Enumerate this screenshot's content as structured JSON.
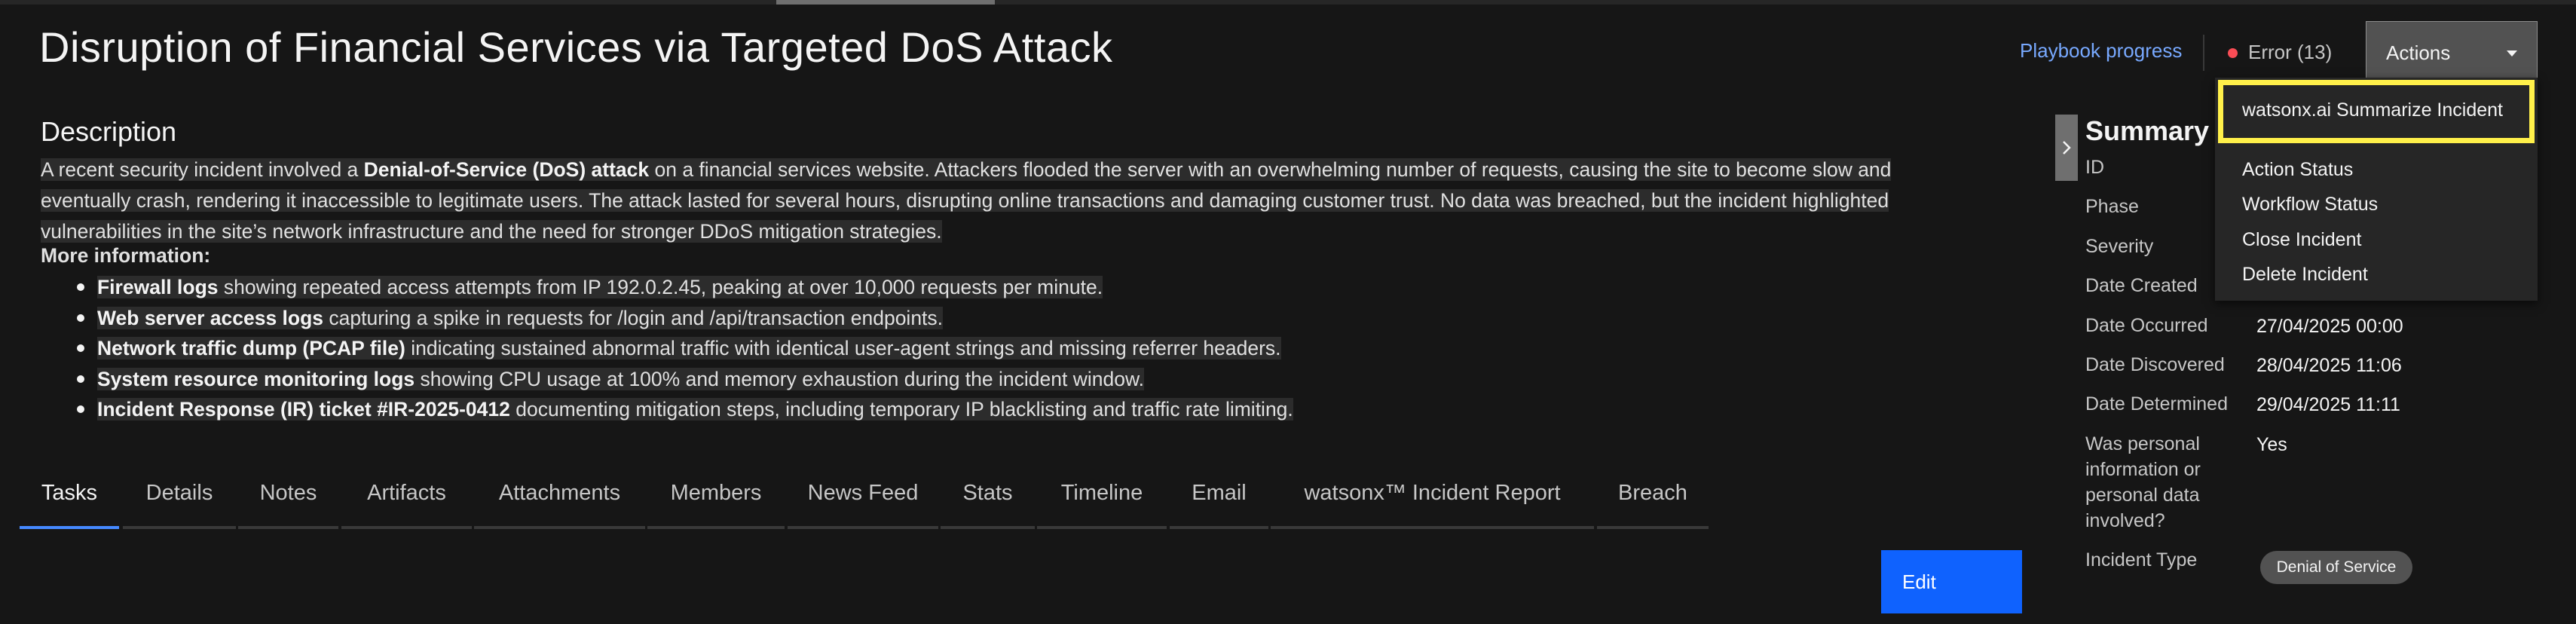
{
  "header": {
    "title": "Disruption of Financial Services via Targeted DoS Attack",
    "playbook_progress": "Playbook progress",
    "error": "Error (13)",
    "actions_label": "Actions"
  },
  "actions_menu": {
    "items": [
      "watsonx.ai Summarize Incident",
      "Action Status",
      "Workflow Status",
      "Close Incident",
      "Delete Incident"
    ]
  },
  "description": {
    "heading": "Description",
    "intro_before": "A recent security incident involved a ",
    "intro_bold": "Denial-of-Service (DoS) attack",
    "intro_after": " on a financial services website. Attackers flooded the server with an overwhelming number of requests, causing the site to become slow and eventually crash, rendering it inaccessible to legitimate users. The attack lasted for several hours, disrupting online transactions and damaging customer trust. No data was breached, but the incident highlighted vulnerabilities in the site’s network infrastructure and the need for stronger DDoS mitigation strategies.",
    "more_heading": "More information:",
    "bullets": [
      {
        "bold": "Firewall logs",
        "text": " showing repeated access attempts from IP 192.0.2.45, peaking at over 10,000 requests per minute."
      },
      {
        "bold": "Web server access logs",
        "text": " capturing a spike in requests for /login and /api/transaction endpoints."
      },
      {
        "bold": "Network traffic dump (PCAP file)",
        "text": " indicating sustained abnormal traffic with identical user-agent strings and missing referrer headers."
      },
      {
        "bold": "System resource monitoring logs",
        "text": " showing CPU usage at 100% and memory exhaustion during the incident window."
      },
      {
        "bold": "Incident Response (IR) ticket #IR-2025-0412",
        "text": " documenting mitigation steps, including temporary IP blacklisting and traffic rate limiting."
      }
    ]
  },
  "tabs": [
    "Tasks",
    "Details",
    "Notes",
    "Artifacts",
    "Attachments",
    "Members",
    "News Feed",
    "Stats",
    "Timeline",
    "Email",
    "watsonx™ Incident Report",
    "Breach"
  ],
  "active_tab": "Tasks",
  "edit_label": "Edit",
  "summary": {
    "title": "Summary",
    "fields": [
      {
        "label": "ID",
        "value": ""
      },
      {
        "label": "Phase",
        "value": ""
      },
      {
        "label": "Severity",
        "value": ""
      },
      {
        "label": "Date Created",
        "value": ""
      },
      {
        "label": "Date Occurred",
        "value": "27/04/2025 00:00"
      },
      {
        "label": "Date Discovered",
        "value": "28/04/2025 11:06"
      },
      {
        "label": "Date Determined",
        "value": "29/04/2025 11:11"
      },
      {
        "label": "Was personal information or personal data involved?",
        "value": "Yes"
      },
      {
        "label": "Incident Type",
        "value": "Denial of Service"
      }
    ],
    "label_lines": [
      "Was personal",
      "information or",
      "personal data",
      "involved?"
    ]
  },
  "colors": {
    "background": "#161616",
    "link": "#78a9ff",
    "primary_button": "#0f62fe",
    "active_tab": "#4589ff",
    "highlight": "#fff04a",
    "error_dot": "#fa4d56"
  },
  "icons": [
    "chevron-right-icon",
    "caret-down-icon",
    "error-dot-icon"
  ]
}
